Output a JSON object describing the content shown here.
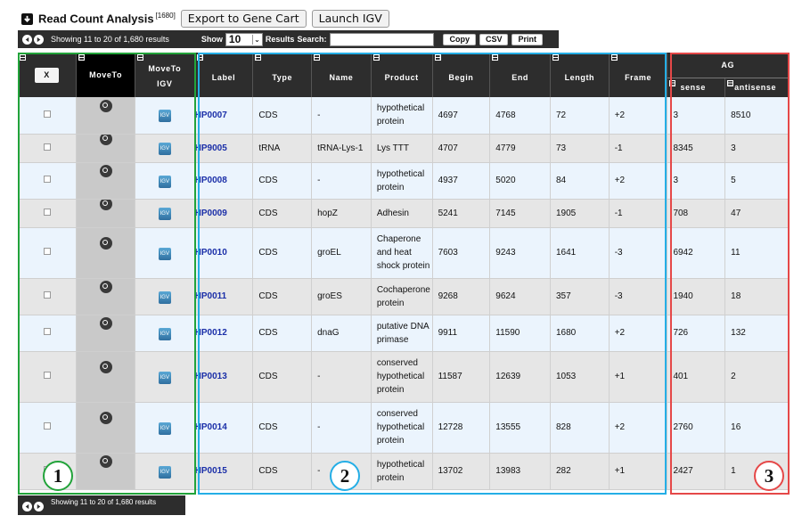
{
  "title": {
    "text": "Read Count Analysis",
    "count": "[1680]",
    "export_label": "Export to Gene Cart",
    "igv_label": "Launch IGV"
  },
  "toolbar": {
    "info": "Showing 11 to 20 of 1,680 results",
    "show_label": "Show",
    "show_value": "10",
    "results_label": "Results",
    "search_label": "Search:",
    "copy_label": "Copy",
    "csv_label": "CSV",
    "print_label": "Print"
  },
  "footer": {
    "info": "Showing 11 to 20 of 1,680 results"
  },
  "headers": {
    "x_label": "X",
    "moveto": "MoveTo",
    "moveto_igv_1": "MoveTo",
    "moveto_igv_2": "IGV",
    "label": "Label",
    "type": "Type",
    "name": "Name",
    "product": "Product",
    "begin": "Begin",
    "end": "End",
    "length": "Length",
    "frame": "Frame",
    "ag": "AG",
    "sense": "sense",
    "antisense": "antisense"
  },
  "rows": [
    {
      "label": "HP0007",
      "type": "CDS",
      "name": "-",
      "product": "hypothetical protein",
      "begin": "4697",
      "end": "4768",
      "length": "72",
      "frame": "+2",
      "sense": "3",
      "antisense": "8510"
    },
    {
      "label": "HP9005",
      "type": "tRNA",
      "name": "tRNA-Lys-1",
      "product": "Lys TTT",
      "begin": "4707",
      "end": "4779",
      "length": "73",
      "frame": "-1",
      "sense": "8345",
      "antisense": "3"
    },
    {
      "label": "HP0008",
      "type": "CDS",
      "name": "-",
      "product": "hypothetical protein",
      "begin": "4937",
      "end": "5020",
      "length": "84",
      "frame": "+2",
      "sense": "3",
      "antisense": "5"
    },
    {
      "label": "HP0009",
      "type": "CDS",
      "name": "hopZ",
      "product": "Adhesin",
      "begin": "5241",
      "end": "7145",
      "length": "1905",
      "frame": "-1",
      "sense": "708",
      "antisense": "47"
    },
    {
      "label": "HP0010",
      "type": "CDS",
      "name": "groEL",
      "product": "Chaperone and heat shock protein",
      "begin": "7603",
      "end": "9243",
      "length": "1641",
      "frame": "-3",
      "sense": "6942",
      "antisense": "11"
    },
    {
      "label": "HP0011",
      "type": "CDS",
      "name": "groES",
      "product": "Cochaperone protein",
      "begin": "9268",
      "end": "9624",
      "length": "357",
      "frame": "-3",
      "sense": "1940",
      "antisense": "18"
    },
    {
      "label": "HP0012",
      "type": "CDS",
      "name": "dnaG",
      "product": "putative DNA primase",
      "begin": "9911",
      "end": "11590",
      "length": "1680",
      "frame": "+2",
      "sense": "726",
      "antisense": "132"
    },
    {
      "label": "HP0013",
      "type": "CDS",
      "name": "-",
      "product": "conserved hypothetical protein",
      "begin": "11587",
      "end": "12639",
      "length": "1053",
      "frame": "+1",
      "sense": "401",
      "antisense": "2"
    },
    {
      "label": "HP0014",
      "type": "CDS",
      "name": "-",
      "product": "conserved hypothetical protein",
      "begin": "12728",
      "end": "13555",
      "length": "828",
      "frame": "+2",
      "sense": "2760",
      "antisense": "16"
    },
    {
      "label": "HP0015",
      "type": "CDS",
      "name": "-",
      "product": "hypothetical protein",
      "begin": "13702",
      "end": "13983",
      "length": "282",
      "frame": "+1",
      "sense": "2427",
      "antisense": "1"
    }
  ],
  "callouts": {
    "one": "1",
    "two": "2",
    "three": "3"
  },
  "colors": {
    "highlight_1": "#22a33a",
    "highlight_2": "#24aee6",
    "highlight_3": "#e54848",
    "label_link": "#1b2fa8",
    "toolbar_bg": "#2d2d2d"
  }
}
